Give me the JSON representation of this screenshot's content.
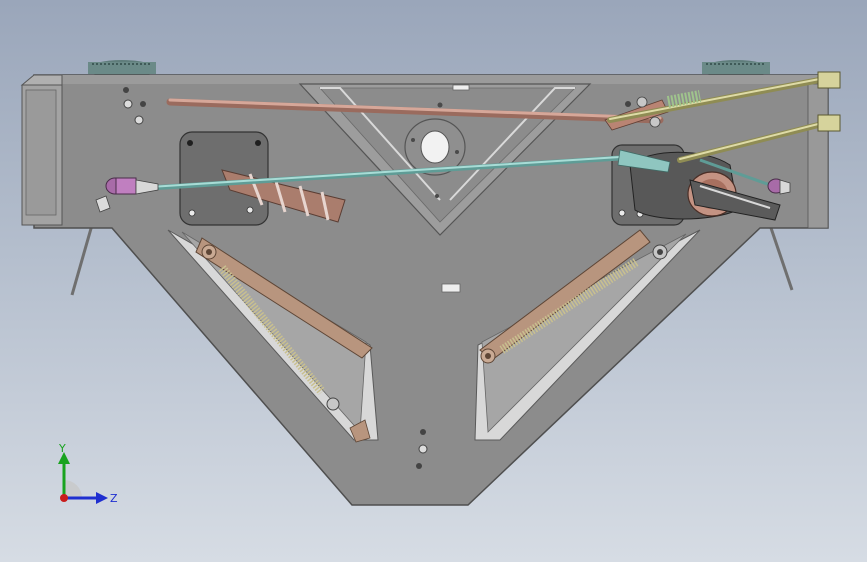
{
  "view": {
    "background_top": "#9aa6ba",
    "background_bottom": "#d6dce4"
  },
  "colors": {
    "frame": "#8c8c8c",
    "frame_dark": "#5e5e5e",
    "frame_light": "#ababab",
    "rod_copper": "#c08a7a",
    "rod_teal": "#8fc6c0",
    "rod_olive": "#c4c28a",
    "arm_brown": "#b8957e",
    "spring": "#c9c08f",
    "cam_copper": "#b87b68",
    "end_pink": "#c07fc0"
  },
  "triad": {
    "y_label": "Y",
    "z_label": "Z",
    "y_color": "#19a31f",
    "z_color": "#1f2fd0",
    "origin_color": "#c81c1c"
  },
  "icons": {
    "triad": "axis-triad-icon"
  }
}
